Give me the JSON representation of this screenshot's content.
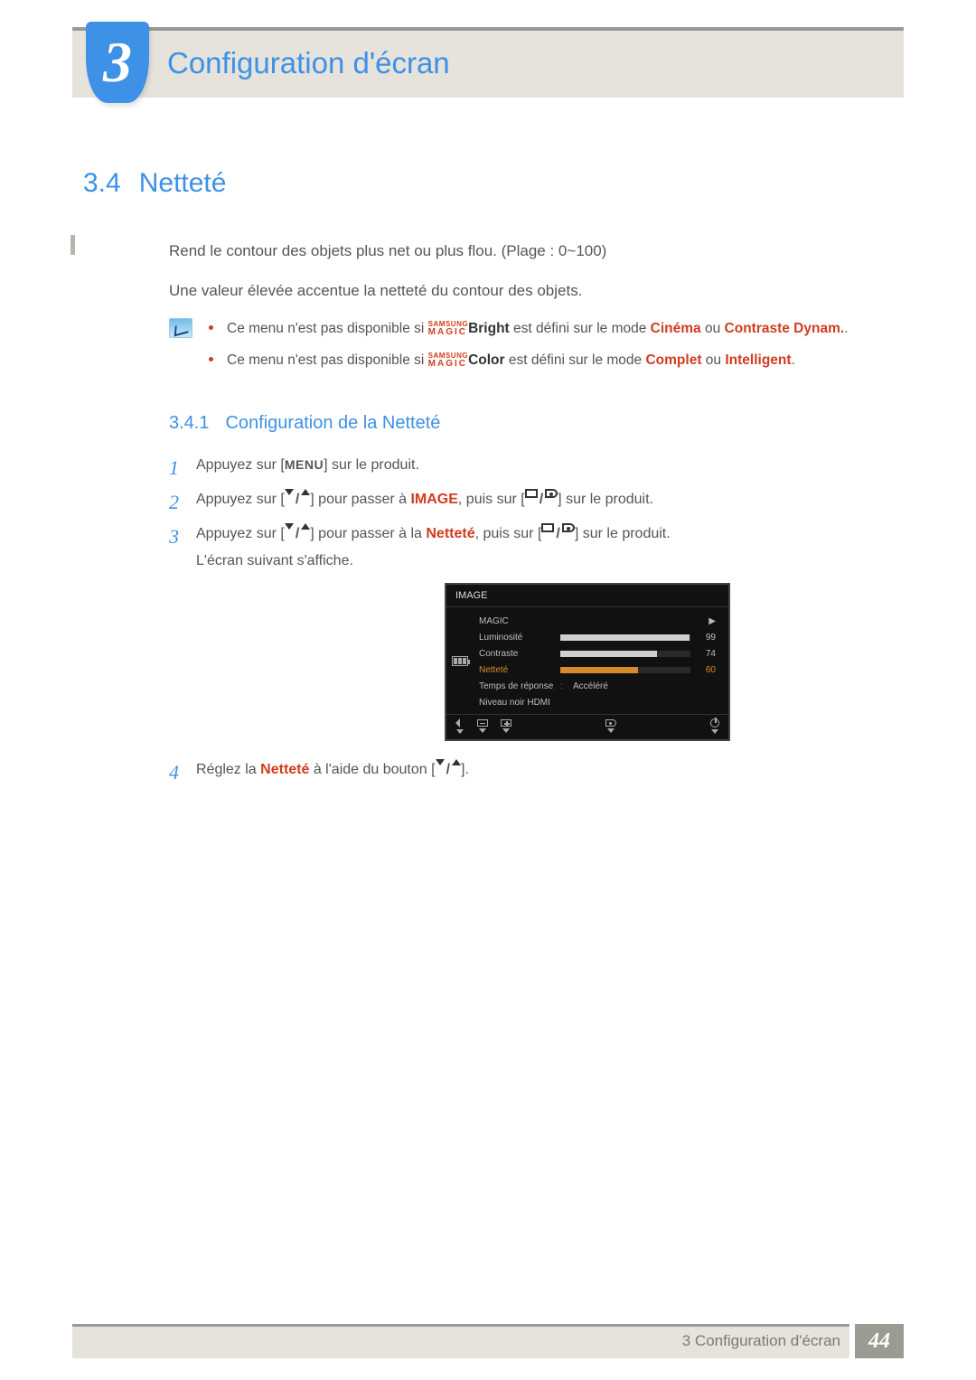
{
  "chapter": {
    "number": "3",
    "title": "Configuration d'écran"
  },
  "section": {
    "number": "3.4",
    "title": "Netteté"
  },
  "intro": {
    "p1": "Rend le contour des objets plus net ou plus flou. (Plage : 0~100)",
    "p2": "Une valeur élevée accentue la netteté du contour des objets."
  },
  "notes": {
    "n1": {
      "pre": "Ce menu n'est pas disponible si ",
      "brand_top": "SAMSUNG",
      "brand_bot": "MAGIC",
      "brand_suffix": "Bright",
      "mid": " est défini sur le mode ",
      "m1": "Cinéma",
      "or": " ou ",
      "m2": "Contraste Dynam.",
      "end": "."
    },
    "n2": {
      "pre": "Ce menu n'est pas disponible si ",
      "brand_top": "SAMSUNG",
      "brand_bot": "MAGIC",
      "brand_suffix": "Color",
      "mid": " est défini sur le mode ",
      "m1": "Complet",
      "or": " ou ",
      "m2": "Intelligent",
      "end": "."
    }
  },
  "subsection": {
    "number": "3.4.1",
    "title": "Configuration de la Netteté"
  },
  "steps": {
    "s1": {
      "num": "1",
      "a": "Appuyez sur [",
      "menu": "MENU",
      "b": "] sur le produit."
    },
    "s2": {
      "num": "2",
      "a": "Appuyez sur [",
      "b": "] pour passer à ",
      "target": "IMAGE",
      "c": ", puis sur [",
      "d": "] sur le produit."
    },
    "s3": {
      "num": "3",
      "a": "Appuyez sur [",
      "b": "] pour passer à la ",
      "target": "Netteté",
      "c": ", puis sur [",
      "d": "] sur le produit.",
      "sub": "L'écran suivant s'affiche."
    },
    "s4": {
      "num": "4",
      "a": "Réglez la ",
      "target": "Netteté",
      "b": " à l'aide du bouton [",
      "c": "]."
    }
  },
  "osd": {
    "title": "IMAGE",
    "rows": {
      "magic": {
        "label": "MAGIC"
      },
      "lum": {
        "label": "Luminosité",
        "value": "99",
        "fill": 99
      },
      "contr": {
        "label": "Contraste",
        "value": "74",
        "fill": 74
      },
      "net": {
        "label": "Netteté",
        "value": "60",
        "fill": 60
      },
      "temps": {
        "label": "Temps de réponse",
        "value_text": "Accéléré"
      },
      "hdmi": {
        "label": "Niveau noir HDMI"
      }
    }
  },
  "footer": {
    "text": "3 Configuration d'écran",
    "page": "44"
  }
}
